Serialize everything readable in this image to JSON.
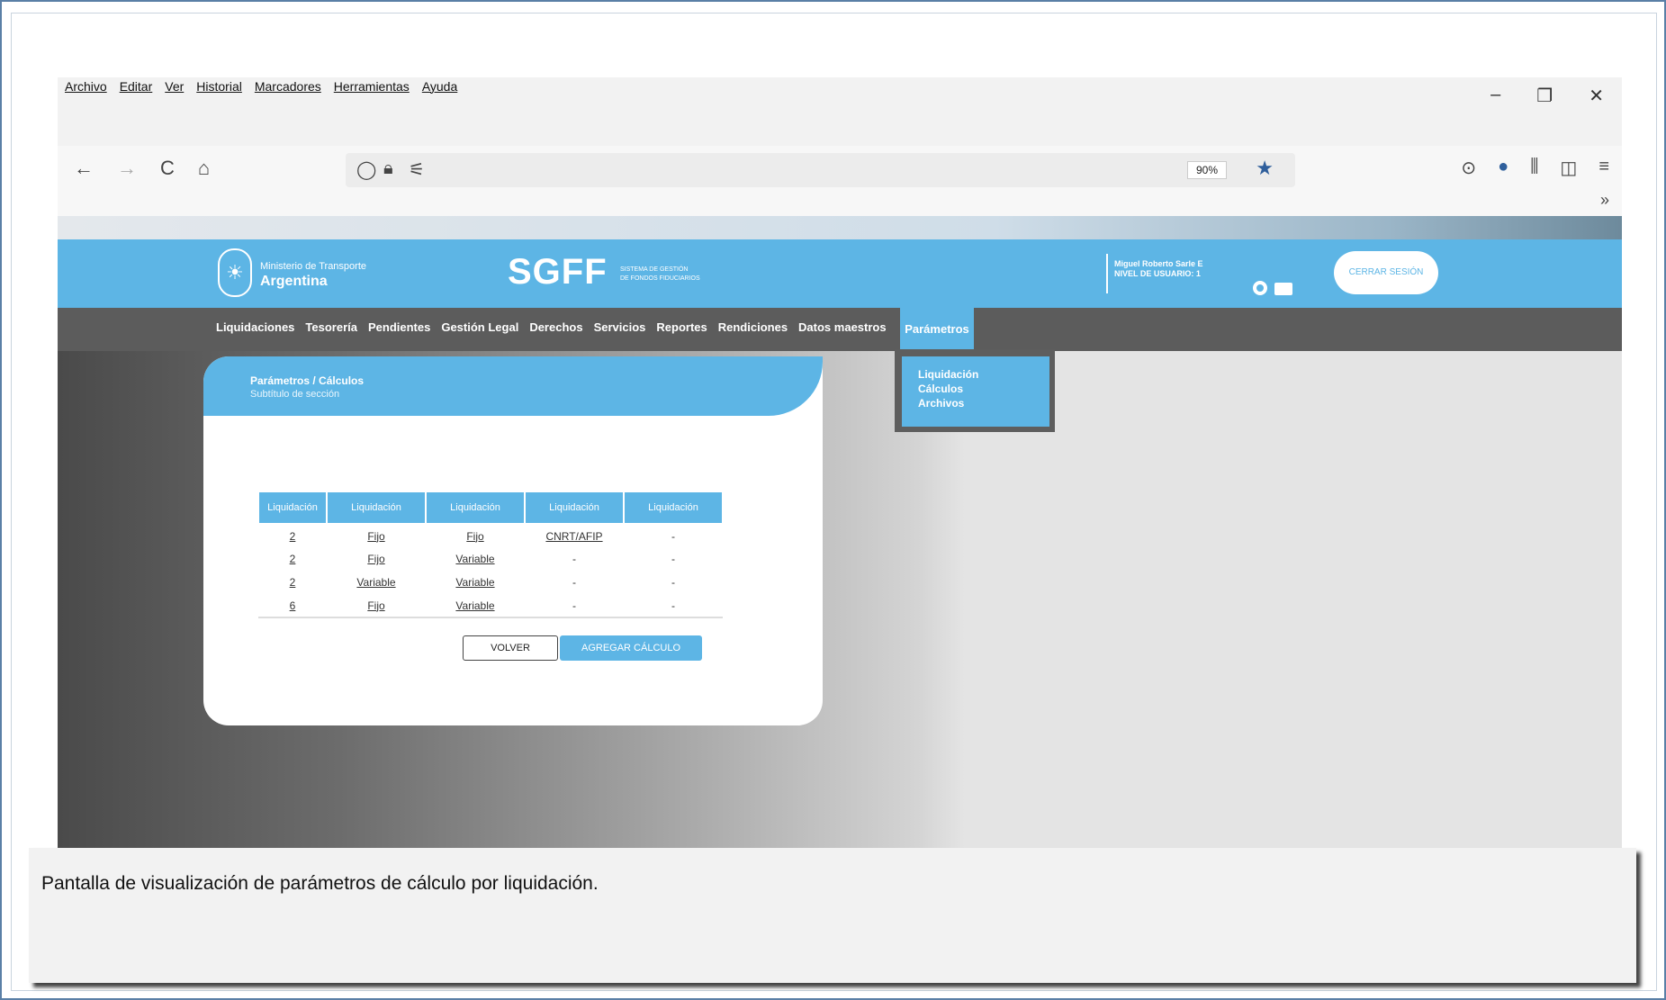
{
  "browser": {
    "menus": [
      "Archivo",
      "Editar",
      "Ver",
      "Historial",
      "Marcadores",
      "Herramientas",
      "Ayuda"
    ],
    "window_controls": [
      "–",
      "❐",
      "✕"
    ],
    "nav": {
      "back": "←",
      "forward": "→",
      "reload": "C",
      "home": "⌂"
    },
    "url_icons": {
      "shield": "◯",
      "lock": "🔒︎",
      "perms": "⚟"
    },
    "zoom": "90%",
    "bookmark_star": "★",
    "right_icons": [
      "⊙",
      "●",
      "⫼",
      "◫",
      "≡"
    ],
    "overflow": "»"
  },
  "header": {
    "ministry_small": "Ministerio de Transporte",
    "ministry_big": "Argentina",
    "app_name": "SGFF",
    "app_sub1": "SISTEMA DE GESTIÓN",
    "app_sub2": "DE FONDOS FIDUCIARIOS",
    "user_name": "Miguel Roberto Sarle E",
    "user_level": "NIVEL DE USUARIO: 1",
    "logout_label": "CERRAR SESIÓN"
  },
  "mainnav": {
    "items": [
      "Liquidaciones",
      "Tesorería",
      "Pendientes",
      "Gestión Legal",
      "Derechos",
      "Servicios",
      "Reportes",
      "Rendiciones",
      "Datos maestros"
    ],
    "active": "Parámetros",
    "dropdown": [
      "Liquidación",
      "Cálculos",
      "Archivos"
    ]
  },
  "card": {
    "title": "Parámetros / Cálculos",
    "subtitle": "Subtítulo de sección",
    "table": {
      "headers": [
        "Liquidación",
        "Liquidación",
        "Liquidación",
        "Liquidación",
        "Liquidación"
      ],
      "rows": [
        [
          "2",
          "Fijo",
          "Fijo",
          "CNRT/AFIP",
          "-"
        ],
        [
          "2",
          "Fijo",
          "Variable",
          "-",
          "-"
        ],
        [
          "2",
          "Variable",
          "Variable",
          "-",
          "-"
        ],
        [
          "6",
          "Fijo",
          "Variable",
          "-",
          "-"
        ]
      ]
    },
    "btn_volver": "VOLVER",
    "btn_agregar": "AGREGAR CÁLCULO"
  },
  "caption": "Pantalla de visualización de parámetros de cálculo por liquidación."
}
